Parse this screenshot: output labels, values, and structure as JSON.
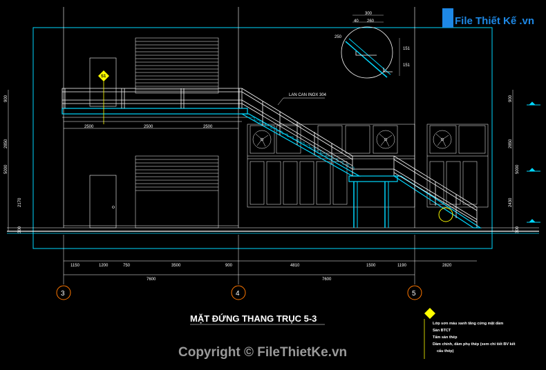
{
  "title": "MẶT ĐỨNG THANG TRỤC 5-3",
  "logo": "File Thiết Kế .vn",
  "watermark": "Copyright © FileThietKe.vn",
  "callout": "LAN CAN INOX 304",
  "tag": "S1",
  "axes": [
    "3",
    "4",
    "5"
  ],
  "dims_top": [
    "2500",
    "2500",
    "2500"
  ],
  "dims_bottom": [
    "1150",
    "1200",
    "750",
    "3500",
    "900",
    "4810",
    "1500",
    "1190",
    "2820"
  ],
  "dims_overall": [
    "7600",
    "7600"
  ],
  "dims_left": [
    "900",
    "2850",
    "5000",
    "2170",
    "300"
  ],
  "dims_right": [
    "900",
    "2850",
    "5000",
    "2430",
    "300"
  ],
  "detail_dims": [
    "300",
    "40",
    "260",
    "250",
    "151",
    "151"
  ],
  "notes": [
    "Lớp sơn màu xanh tăng cứng mặt dầm",
    "Sàn BTCT",
    "Tấm sàn thép",
    "Dầm chính, dầm phụ thép (xem chi tiết BV kết",
    "cấu thép)"
  ],
  "colors": {
    "line": "#ffffff",
    "accent": "#00d8ff",
    "marker": "#ffff00"
  }
}
